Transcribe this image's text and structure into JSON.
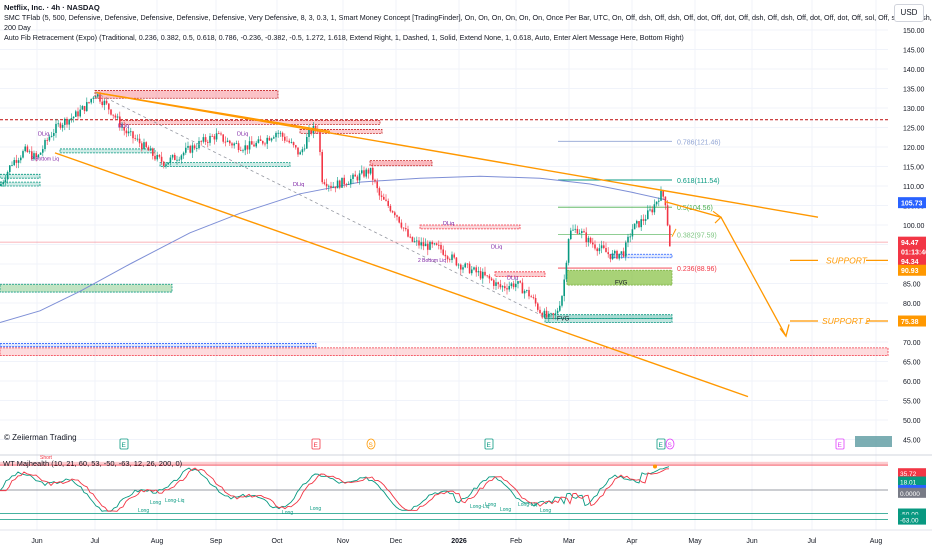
{
  "header": {
    "title": "Netflix, Inc. · 4h · NASDAQ",
    "indicator1": "SMC TFlab (5, 500, Defensive, Defensive, Defensive, Defensive, Defensive, Very Defensive, 8, 3, 0.3, 1, Smart Money Concept [TradingFinder], On, On, On, On, On, On, Once Per Bar, UTC, On, Off, dsh, Off, dsh, Off, dot, Off, dot, Off, dsh, Off, dsh, Off, dot, Off, dot, Off, sol, Off, sol, Off, dsh, Off, dsh)",
    "indicator2": "200 Day",
    "indicator3": "Auto Fib Retracement (Expo) (Traditional, 0.236, 0.382, 0.5, 0.618, 0.786, -0.236, -0.382, -0.5, 1.272, 1.618, Extend Right, 1, Dashed, 1, Solid, Extend None, 1, 0.618, Auto, Enter Alert Message Here, Bottom Right)",
    "currency": "USD"
  },
  "credit": "© Zeiierman Trading",
  "oscillator": {
    "title": "WT Majhealth (10, 21, 60, 53, -50, -63, 12, 26, 200, 0)",
    "scale_labels": [
      {
        "text": "35.72",
        "bg": "#f23645",
        "fg": "#ffffff",
        "v": 35.72
      },
      {
        "text": "18.01",
        "bg": "#089981",
        "fg": "#ffffff",
        "v": 18.01
      },
      {
        "text": "0.0000",
        "bg": "#2962ff",
        "fg": "#ffffff",
        "v": 0
      },
      {
        "text": "0.0000",
        "bg": "#787b86",
        "fg": "#ffffff",
        "v": -6
      },
      {
        "text": "-50.00",
        "bg": "#089981",
        "fg": "#ffffff",
        "v": -50
      },
      {
        "text": "-63.00",
        "bg": "#089981",
        "fg": "#ffffff",
        "v": -63
      }
    ],
    "short_label": "Short",
    "long_label": "Long",
    "long_label2": "Long-Liq"
  },
  "annotations": {
    "support1": "SUPPORT",
    "support2": "SUPPORT 2",
    "fvg": "FVG",
    "dliq": "DLiq",
    "bottom_liq": "2 Bottom Liq",
    "e_marker": "E",
    "s_marker": "S"
  },
  "chart_data": {
    "type": "candlestick",
    "title": "Netflix, Inc. · 4h · NASDAQ",
    "xlabel": "",
    "ylabel": "",
    "ylim": [
      45,
      155
    ],
    "x_ticks": [
      "Jun",
      "Jul",
      "Aug",
      "Sep",
      "Oct",
      "Nov",
      "Dec",
      "2026",
      "Feb",
      "Mar",
      "Apr",
      "May",
      "Jun",
      "Jul",
      "Aug"
    ],
    "y_ticks": [
      45,
      50,
      55,
      60,
      65,
      70,
      75,
      80,
      85,
      90,
      95,
      100,
      105,
      110,
      115,
      120,
      125,
      130,
      135,
      140,
      145,
      150
    ],
    "price_path": [
      [
        "Jun",
        117
      ],
      [
        "mid-Jun",
        123
      ],
      [
        "Jul",
        134
      ],
      [
        "mid-Jul",
        125
      ],
      [
        "Aug",
        117
      ],
      [
        "mid-Aug",
        119
      ],
      [
        "Sep",
        123
      ],
      [
        "mid-Sep",
        120
      ],
      [
        "Oct",
        125
      ],
      [
        "mid-Oct",
        113
      ],
      [
        "Nov",
        110
      ],
      [
        "mid-Nov",
        107
      ],
      [
        "Dec",
        96
      ],
      [
        "mid-Dec",
        92
      ],
      [
        "2026",
        88
      ],
      [
        "mid-Jan",
        84
      ],
      [
        "Feb",
        83
      ],
      [
        "mid-Feb",
        77
      ],
      [
        "Mar",
        98
      ],
      [
        "mid-Mar",
        95
      ],
      [
        "Apr",
        99
      ],
      [
        "mid-Apr",
        107
      ],
      [
        "late-Apr",
        94.47
      ]
    ],
    "fib_levels": [
      {
        "label": "0.786(121.46)",
        "value": 121.46,
        "color": "#90a4d4"
      },
      {
        "label": "0.618(111.54)",
        "value": 111.54,
        "color": "#089981"
      },
      {
        "label": "0.5(104.56)",
        "value": 104.56,
        "color": "#4caf50"
      },
      {
        "label": "0.382(97.59)",
        "value": 97.59,
        "color": "#81c784"
      },
      {
        "label": "0.236(88.96)",
        "value": 88.96,
        "color": "#f23645"
      }
    ],
    "price_labels": [
      {
        "text": "105.73",
        "value": 105.73,
        "bg": "#2962ff"
      },
      {
        "text": "94.47",
        "value": 95.6,
        "bg": "#f23645"
      },
      {
        "text": "01:13:46",
        "value": 93.2,
        "bg": "#f23645"
      },
      {
        "text": "94.34",
        "value": 90.8,
        "bg": "#f23645"
      },
      {
        "text": "90.93",
        "value": 88.4,
        "bg": "#ff9800"
      },
      {
        "text": "75.38",
        "value": 75.38,
        "bg": "#ff9800"
      }
    ],
    "support_levels": [
      {
        "name": "SUPPORT",
        "value": 90.93
      },
      {
        "name": "SUPPORT 2",
        "value": 75.38
      }
    ],
    "channel": {
      "upper": [
        [
          "Jul",
          134
        ],
        [
          "Jul (next year)",
          102
        ]
      ],
      "lower": [
        [
          "mid-Jun",
          118
        ],
        [
          "Aug",
          56
        ]
      ]
    },
    "projection": [
      [
        "late-Apr",
        105.7
      ],
      [
        "mid-Jun",
        71.5
      ]
    ]
  }
}
